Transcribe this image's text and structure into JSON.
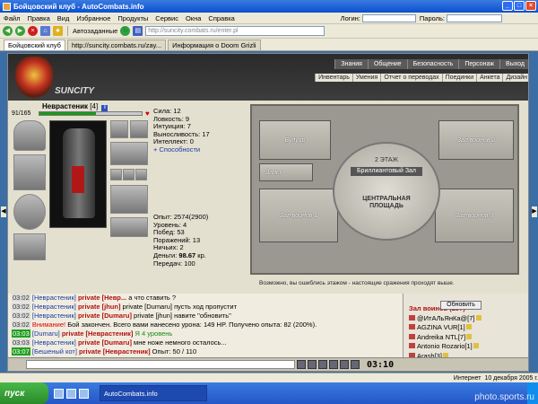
{
  "window": {
    "title": "Бойцовский клуб - AutoCombats.info"
  },
  "menu": {
    "items": [
      "Файл",
      "Правка",
      "Вид",
      "Избранное",
      "Продукты",
      "Сервис",
      "Окна",
      "Справка"
    ],
    "login_label": "Логин:",
    "password_label": "Пароль:"
  },
  "toolbar": {
    "autofill_label": "Автозаданные",
    "address": "http://suncity.combats.ru/enter.pl"
  },
  "tabs": [
    {
      "label": "Бойцовский клуб"
    },
    {
      "label": "http://suncity.combats.ru/zay..."
    },
    {
      "label": "Информация о Doom Grizli"
    }
  ],
  "game": {
    "logo": "SUNCITY",
    "topnav": [
      "Знания",
      "Общение",
      "Безопасность",
      "Персонаж",
      "Выход"
    ],
    "subnav": [
      "Инвентарь",
      "Умения",
      "Отчет о переводах",
      "Поединки",
      "Анкета",
      "Дизайн"
    ],
    "character": {
      "name": "Неврастеник",
      "level": "[4]",
      "hp": "91/165",
      "hp_fraction": 0.55,
      "stats": [
        "Сила: 12",
        "Ловкость: 9",
        "Интуиция: 7",
        "Выносливость: 17",
        "Интеллект: 0"
      ],
      "abilities_link": "+ Способности",
      "exp": "Опыт: 2574(2900)",
      "level_line": "Уровень: 4",
      "wins": "Побед: 53",
      "losses": "Поражений: 13",
      "draws": "Ничьих: 2",
      "money_label": "Деньги:",
      "money_value": "98.67",
      "money_unit": "кр.",
      "transfers": "Передач: 100"
    },
    "map": {
      "rooms": [
        "Будуар",
        "Зал воинов 2",
        "Залы",
        "Зал воинов 1",
        "Зал воинов 3"
      ],
      "floor": "2 ЭТАЖ",
      "current": "Бриллиантовый Зал",
      "plaza": "ЦЕНТРАЛЬНАЯ ПЛОЩАДЬ",
      "note": "Возможно, вы ошиблись этажом - настоящие сражения проходят выше."
    },
    "chat": [
      {
        "time": "03:02",
        "from": "[Неврастеник]",
        "priv": "private [Невр...",
        "text": "а что ставить ?"
      },
      {
        "time": "03:02",
        "from": "[Неврастеник]",
        "priv": "private [jhun]",
        "text": "private [Dumaru] пусть ход пропустит"
      },
      {
        "time": "03:02",
        "from": "[Неврастеник]",
        "priv": "private [Dumaru]",
        "text": "private [jhun] навите \"обновить\""
      },
      {
        "time": "03:02",
        "from": "Внимание!",
        "priv": "",
        "text": "Бой закончен. Всего вами нанесено урона: 149 HP. Получено опыта: 82 (200%)."
      },
      {
        "time": "03:03",
        "from": "[Dumaru]",
        "priv": "private [Неврастеник]",
        "text": "Я 4 уровень"
      },
      {
        "time": "03:03",
        "from": "[Неврастеник]",
        "priv": "private [Dumaru]",
        "text": "мне ноже немного осталось..."
      },
      {
        "time": "03:07",
        "from": "[Бешеный кот]",
        "priv": "private [Неврастеник]",
        "text": "Опыт: 50 / 110"
      },
      {
        "time": "10.12.05 03:09",
        "from": "Неврастеник",
        "priv": "",
        "text": "достиг уровня 4!"
      },
      {
        "time": "03:10",
        "from": "Внимание!",
        "priv": "",
        "text": "Бой закончен. Всего вами нанесено урона: 488 HP. Получено опыта: 266 (200%)."
      },
      {
        "time": "03:10",
        "from": "[Бешеный кот]",
        "priv": "private [Неврастеник]",
        "text": "10.12.05 03:09 Неврастеник достиг уровня 4!"
      },
      {
        "time": "",
        "from": "",
        "priv": "",
        "text": ""
      },
      {
        "time": "03:10",
        "from": "[Неврастеник]",
        "priv": "private [Бешеный кот]",
        "text": ""
      },
      {
        "time": "03:10",
        "from": "[Бешеный кот]",
        "priv": "private [Неврастеник]",
        "text": "молодец!"
      }
    ],
    "online": {
      "refresh_label": "Обновить",
      "room_title": "Зал воинов (297)",
      "players": [
        "@ИтАЛьЯнКа@[7]",
        "AGZINA VUR[1]",
        "Andreika NTL[7]",
        "Antonio Rozario[1]",
        "Arash[3]",
        "Arkey[4]",
        "Asassine[2]",
        "Asklep[4]"
      ]
    },
    "clock": "03:10"
  },
  "status": {
    "zone": "Интернет",
    "date": "10 декабря 2005 г."
  },
  "taskbar": {
    "start": "пуск",
    "task": "AutoCombats.info"
  },
  "watermark": "photo.sports.ru",
  "colors": {
    "xp_blue": "#3a6ea5",
    "hp_green": "#1a9a1a",
    "private_red": "#b01010"
  }
}
